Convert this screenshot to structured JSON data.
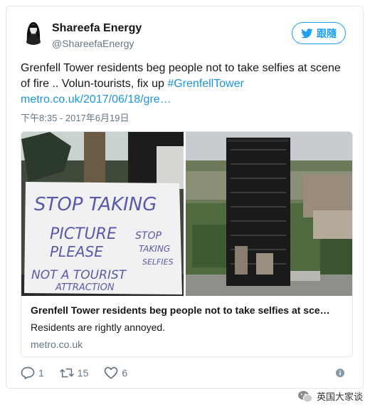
{
  "user": {
    "display_name": "Shareefa Energy",
    "handle": "@ShareefaEnergy"
  },
  "follow_button": {
    "label": "跟隨",
    "icon": "twitter-bird-icon"
  },
  "tweet": {
    "text_line1": "Grenfell Tower residents beg people not to take selfies at scene",
    "text_line2": "of fire .. Volun-tourists, fix up ",
    "hashtag": "#GrenfellTower",
    "link": "metro.co.uk/2017/06/18/gre…",
    "timestamp": "下午8:35 - 2017年6月19日"
  },
  "link_card": {
    "sign_text": [
      "STOP TAKING",
      "PICTURE",
      "PLEASE",
      "STOP",
      "TAKING",
      "SELFIES",
      "NOT A TOURIST",
      "ATTRACTION"
    ],
    "title": "Grenfell Tower residents beg people not to take selfies at sce…",
    "description": "Residents are rightly annoyed.",
    "domain": "metro.co.uk"
  },
  "actions": {
    "reply_count": "1",
    "retweet_count": "15",
    "like_count": "6"
  },
  "watermark": {
    "label": "英国大家谈"
  },
  "colors": {
    "accent": "#1da1f2",
    "link": "#1b95e0",
    "muted": "#657786",
    "border": "#e1e8ed"
  }
}
